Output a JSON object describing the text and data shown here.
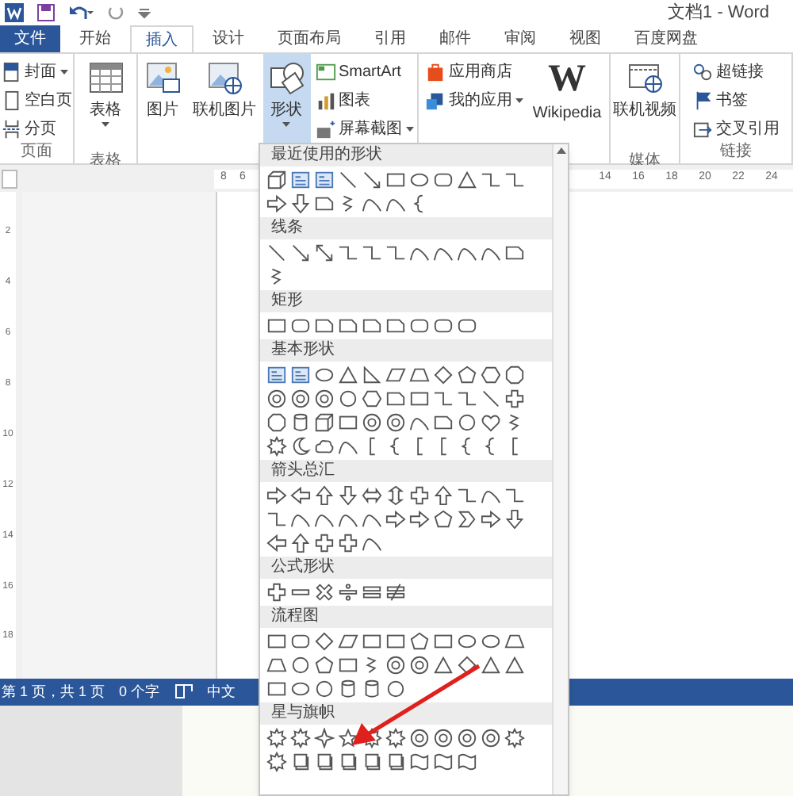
{
  "window": {
    "title": "文档1 - Word"
  },
  "tabs": [
    {
      "label": "文件",
      "kind": "file",
      "selected": false
    },
    {
      "label": "开始",
      "kind": "tab",
      "selected": false
    },
    {
      "label": "插入",
      "kind": "tab",
      "selected": true
    },
    {
      "label": "设计",
      "kind": "tab",
      "selected": false
    },
    {
      "label": "页面布局",
      "kind": "tab",
      "selected": false
    },
    {
      "label": "引用",
      "kind": "tab",
      "selected": false
    },
    {
      "label": "邮件",
      "kind": "tab",
      "selected": false
    },
    {
      "label": "审阅",
      "kind": "tab",
      "selected": false
    },
    {
      "label": "视图",
      "kind": "tab",
      "selected": false
    },
    {
      "label": "百度网盘",
      "kind": "tab",
      "selected": false
    }
  ],
  "ribbon": {
    "groups": [
      {
        "label": "页面",
        "items": [
          {
            "label": "封面",
            "kind": "small",
            "menu": true,
            "pressed": false
          },
          {
            "label": "空白页",
            "kind": "small",
            "menu": false,
            "pressed": false
          },
          {
            "label": "分页",
            "kind": "small",
            "menu": false,
            "pressed": false
          }
        ]
      },
      {
        "label": "表格",
        "items": [
          {
            "label": "表格",
            "kind": "large",
            "menu": true,
            "pressed": false
          }
        ]
      },
      {
        "items": [
          {
            "label": "图片",
            "kind": "large",
            "menu": false,
            "pressed": false
          },
          {
            "label": "联机图片",
            "kind": "large",
            "menu": false,
            "pressed": false
          },
          {
            "label": "形状",
            "kind": "large",
            "menu": true,
            "pressed": true
          },
          {
            "label": "SmartArt",
            "kind": "small",
            "menu": false,
            "pressed": false
          },
          {
            "label": "图表",
            "kind": "small",
            "menu": false,
            "pressed": false
          },
          {
            "label": "屏幕截图",
            "kind": "small",
            "menu": true,
            "pressed": false
          }
        ]
      },
      {
        "items": [
          {
            "label": "应用商店",
            "kind": "small",
            "menu": false,
            "pressed": false
          },
          {
            "label": "我的应用",
            "kind": "small",
            "menu": true,
            "pressed": false
          },
          {
            "label": "Wikipedia",
            "glyph": "W",
            "kind": "large",
            "menu": false,
            "pressed": false
          }
        ]
      },
      {
        "label": "媒体",
        "items": [
          {
            "label": "联机视频",
            "kind": "large",
            "menu": false,
            "pressed": false
          }
        ]
      },
      {
        "label": "链接",
        "items": [
          {
            "label": "超链接",
            "kind": "small",
            "menu": false,
            "pressed": false
          },
          {
            "label": "书签",
            "kind": "small",
            "menu": false,
            "pressed": false
          },
          {
            "label": "交叉引用",
            "kind": "small",
            "menu": false,
            "pressed": false
          }
        ]
      }
    ]
  },
  "ruler": {
    "left_numbers": [
      "8",
      "6"
    ],
    "right_numbers": [
      "14",
      "16",
      "18",
      "20",
      "22",
      "24"
    ],
    "vertical_numbers": [
      "2",
      "4",
      "6",
      "8",
      "10",
      "12",
      "14",
      "16",
      "18"
    ]
  },
  "status_bar": {
    "page": "第 1 页，共 1 页",
    "words": "0 个字",
    "language": "中文"
  },
  "shapes_menu": {
    "sections": [
      {
        "title": "最近使用的形状"
      },
      {
        "title": "线条"
      },
      {
        "title": "矩形"
      },
      {
        "title": "基本形状"
      },
      {
        "title": "箭头总汇"
      },
      {
        "title": "公式形状"
      },
      {
        "title": "流程图"
      },
      {
        "title": "星与旗帜"
      }
    ]
  }
}
